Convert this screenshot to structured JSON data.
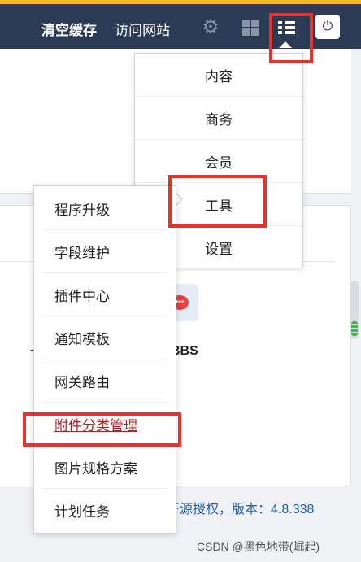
{
  "topbar": {
    "clear_cache": "清空缓存",
    "visit_site": "访问网站",
    "icons": [
      "gear-icon",
      "windows-icon",
      "list-icon",
      "power-icon"
    ]
  },
  "menu": {
    "items": [
      {
        "label": "内容"
      },
      {
        "label": "商务"
      },
      {
        "label": "会员"
      },
      {
        "label": "工具"
      },
      {
        "label": "设置"
      }
    ]
  },
  "tools_menu": {
    "items": [
      {
        "label": "程序升级"
      },
      {
        "label": "字段维护"
      },
      {
        "label": "插件中心"
      },
      {
        "label": "通知模板"
      },
      {
        "label": "网关路由"
      },
      {
        "label": "附件分类管理"
      },
      {
        "label": "图片规格方案"
      },
      {
        "label": "计划任务"
      }
    ],
    "active_index": 5
  },
  "app": {
    "name": "BBS"
  },
  "footer": {
    "license": "开源授权，版本：4.8.338"
  },
  "watermark": "CSDN @黑色地带(崛起)",
  "colors": {
    "topbar": "#2b3a55",
    "accent_top": "#f5b82e",
    "highlight": "#e8332c",
    "active_link": "#b22222"
  }
}
